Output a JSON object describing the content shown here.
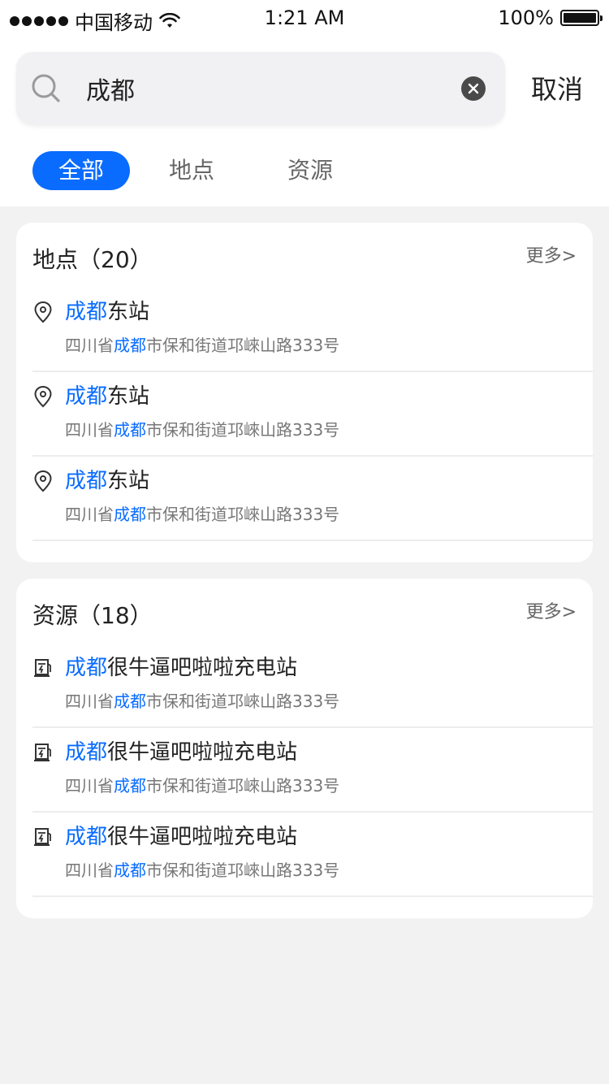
{
  "status_bar": {
    "carrier": "中国移动",
    "time": "1:21 AM",
    "battery": "100%"
  },
  "search": {
    "value": "成都",
    "placeholder": "",
    "cancel_label": "取消"
  },
  "tabs": [
    {
      "label": "全部"
    },
    {
      "label": "地点"
    },
    {
      "label": "资源"
    }
  ],
  "places": {
    "title": "地点（20）",
    "more": "更多>",
    "items": [
      {
        "title_hl": "成都",
        "title_rest": "东站",
        "addr_pre": "四川省",
        "addr_hl": "成都",
        "addr_post": "市保和街道邛崍山路333号"
      },
      {
        "title_hl": "成都",
        "title_rest": "东站",
        "addr_pre": "四川省",
        "addr_hl": "成都",
        "addr_post": "市保和街道邛崍山路333号"
      },
      {
        "title_hl": "成都",
        "title_rest": "东站",
        "addr_pre": "四川省",
        "addr_hl": "成都",
        "addr_post": "市保和街道邛崍山路333号"
      }
    ]
  },
  "resources": {
    "title": "资源（18）",
    "more": "更多>",
    "items": [
      {
        "title_hl": "成都",
        "title_rest": "很牛逼吧啦啦充电站",
        "addr_pre": "四川省",
        "addr_hl": "成都",
        "addr_post": "市保和街道邛崍山路333号"
      },
      {
        "title_hl": "成都",
        "title_rest": "很牛逼吧啦啦充电站",
        "addr_pre": "四川省",
        "addr_hl": "成都",
        "addr_post": "市保和街道邛崍山路333号"
      },
      {
        "title_hl": "成都",
        "title_rest": "很牛逼吧啦啦充电站",
        "addr_pre": "四川省",
        "addr_hl": "成都",
        "addr_post": "市保和街道邛崍山路333号"
      }
    ]
  },
  "colors": {
    "accent": "#0a6cff",
    "page_bg": "#f2f2f3"
  },
  "icons": {
    "place_item": "location-pin-icon",
    "resource_item": "charging-station-icon"
  }
}
